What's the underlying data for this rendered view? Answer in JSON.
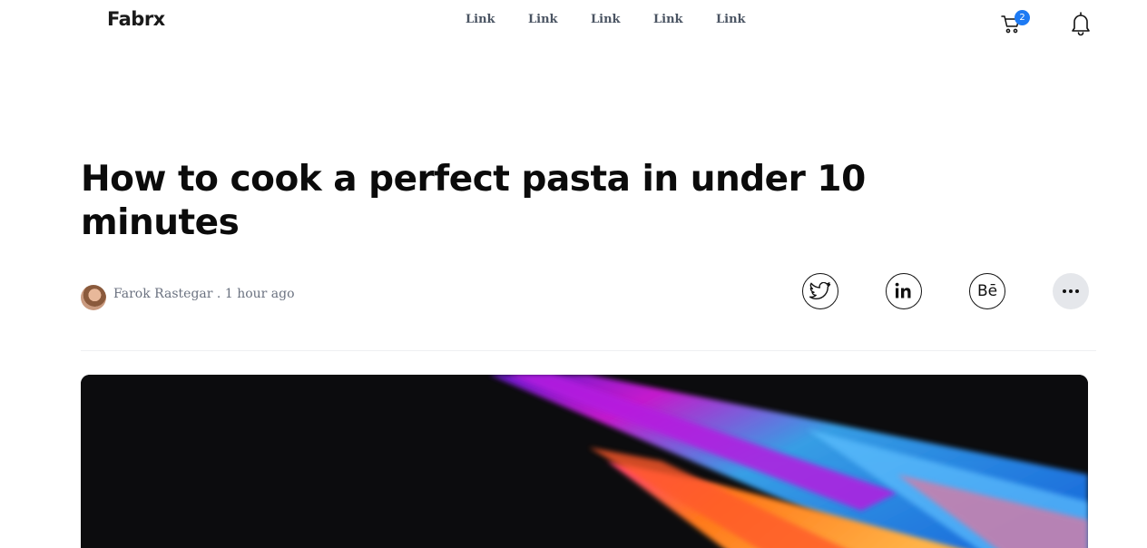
{
  "header": {
    "logo": "Fabrx",
    "nav": [
      "Link",
      "Link",
      "Link",
      "Link",
      "Link"
    ],
    "cart_count": "2"
  },
  "article": {
    "title": "How to cook a perfect pasta in under 10 minutes",
    "author": "Farok Rastegar",
    "separator": " . ",
    "time": "1 hour ago",
    "share_buttons": [
      "twitter-icon",
      "linkedin-icon",
      "behance-icon",
      "more-icon"
    ]
  },
  "colors": {
    "accent": "#1d7af3",
    "text": "#0b0b0b",
    "muted": "#6b7280"
  }
}
